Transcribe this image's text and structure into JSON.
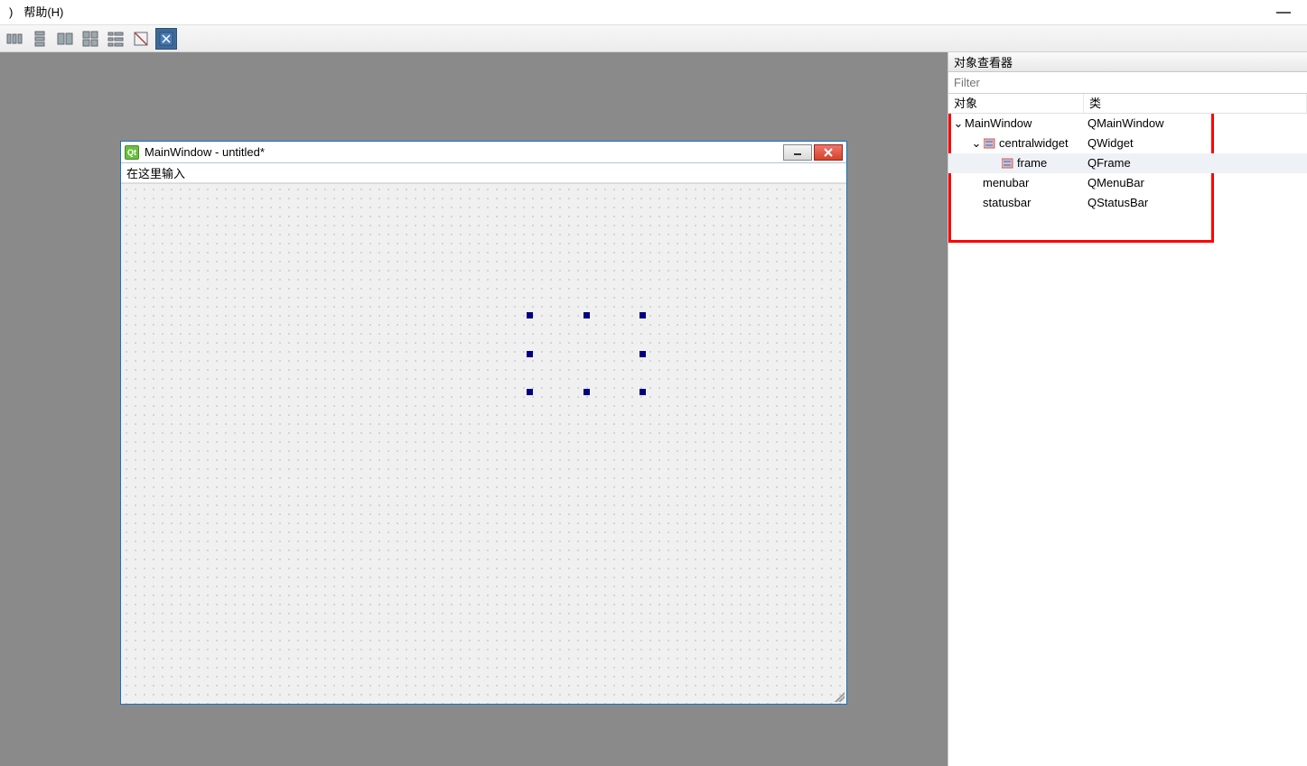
{
  "menu": {
    "left_fragment": ")",
    "help": "帮助(H)"
  },
  "preview": {
    "title": "MainWindow - untitled*",
    "menubar_hint": "在这里输入"
  },
  "inspector": {
    "title": "对象查看器",
    "filter_placeholder": "Filter",
    "headers": {
      "object": "对象",
      "class": "类"
    },
    "rows": [
      {
        "indent": 0,
        "expander": "⌄",
        "icon": "none",
        "object": "MainWindow",
        "class": "QMainWindow",
        "selected": false
      },
      {
        "indent": 1,
        "expander": "⌄",
        "icon": "widget",
        "object": "centralwidget",
        "class": "QWidget",
        "selected": false
      },
      {
        "indent": 2,
        "expander": "",
        "icon": "widget",
        "object": "frame",
        "class": "QFrame",
        "selected": true
      },
      {
        "indent": 1,
        "expander": "",
        "icon": "none",
        "object": "menubar",
        "class": "QMenuBar",
        "selected": false
      },
      {
        "indent": 1,
        "expander": "",
        "icon": "none",
        "object": "statusbar",
        "class": "QStatusBar",
        "selected": false
      }
    ]
  }
}
